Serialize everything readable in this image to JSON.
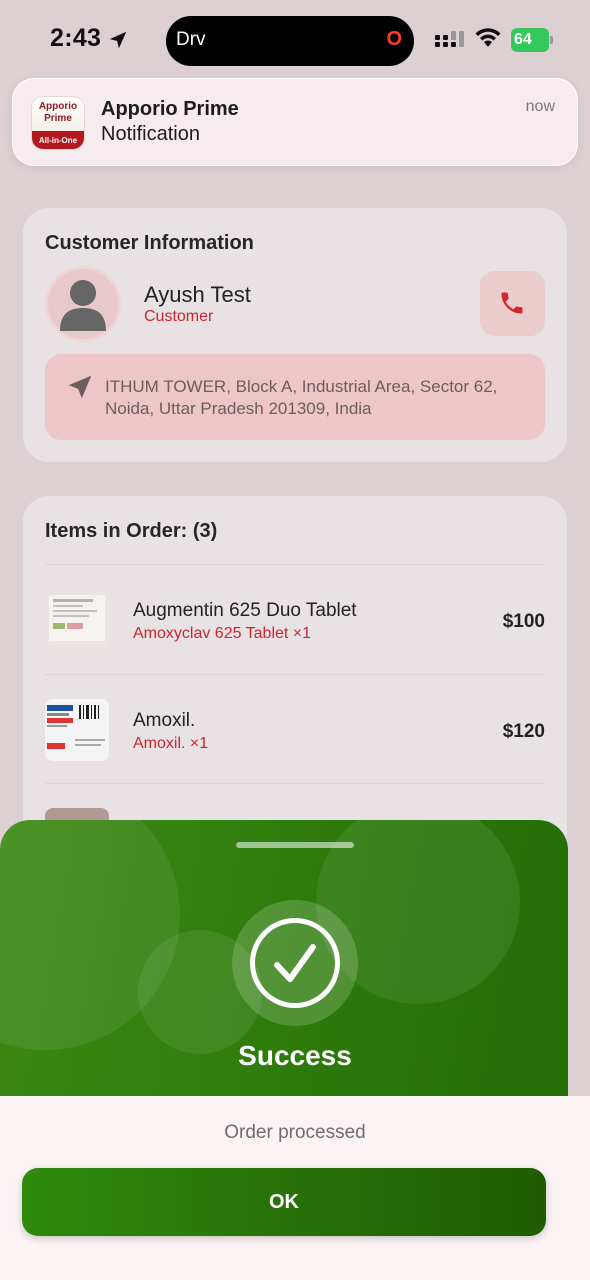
{
  "status_bar": {
    "time": "2:43",
    "island_label": "Drv",
    "island_indicator": "O",
    "battery": "64"
  },
  "notification": {
    "app_name": "Apporio Prime",
    "body": "Notification",
    "time": "now",
    "icon_text_top": "Apporio Prime",
    "icon_text_bottom": "All-in-One"
  },
  "customer": {
    "heading": "Customer Information",
    "name": "Ayush Test",
    "role": "Customer",
    "address": "ITHUM TOWER, Block A, Industrial Area, Sector 62, Noida, Uttar Pradesh 201309, India"
  },
  "order": {
    "heading": "Items in Order: (3)",
    "items": [
      {
        "name": "Augmentin 625 Duo Tablet",
        "sub": "Amoxyclav 625 Tablet  ×1",
        "price": "$100"
      },
      {
        "name": "Amoxil.",
        "sub": "Amoxil.  ×1",
        "price": "$120"
      }
    ]
  },
  "dialog": {
    "title": "Success",
    "message": "Order processed",
    "ok_label": "OK"
  },
  "colors": {
    "accent_red": "#c8272d",
    "success_green": "#2f7d0c"
  },
  "icons": [
    "location-arrow-icon",
    "signal-icon",
    "wifi-icon",
    "battery-icon",
    "user-avatar-icon",
    "phone-icon",
    "navigation-icon",
    "checkmark-icon"
  ]
}
